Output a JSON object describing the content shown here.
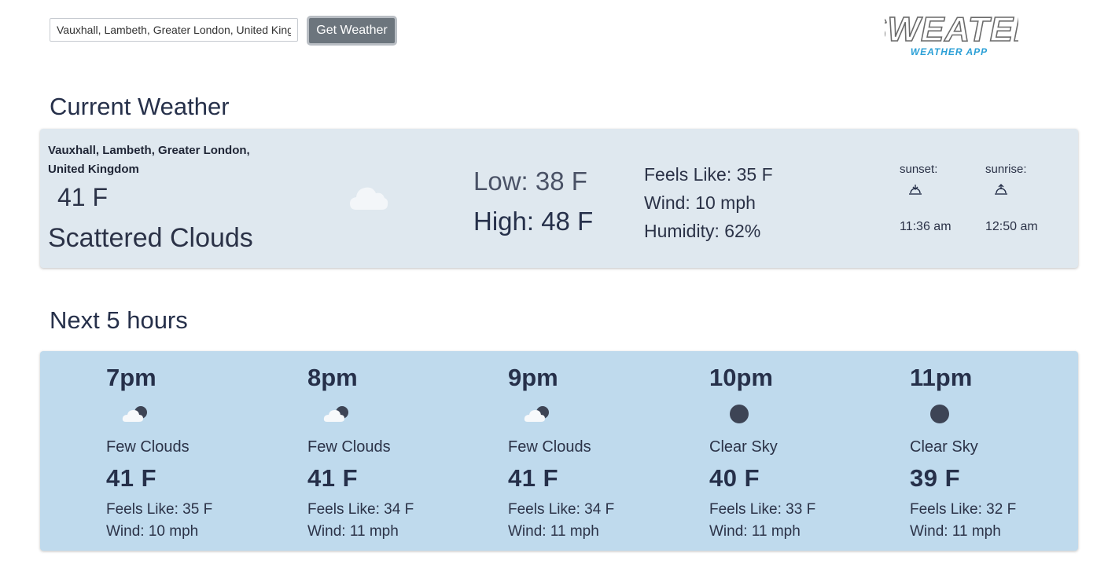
{
  "search": {
    "value": "Vauxhall, Lambeth, Greater London, United Kingdom"
  },
  "get_weather_label": "Get Weather",
  "logo": {
    "title": "SWEATER",
    "subtitle": "WEATHER APP"
  },
  "current": {
    "section_title": "Current Weather",
    "location": "Vauxhall, Lambeth, Greater London, United Kingdom",
    "temp": "41 F",
    "description": "Scattered Clouds",
    "icon": "cloud-icon",
    "low": "Low: 38 F",
    "high": "High: 48 F",
    "feels_like": "Feels Like: 35 F",
    "wind": "Wind: 10 mph",
    "humidity": "Humidity: 62%",
    "sunset_label": "sunset:",
    "sunset_time": "11:36 am",
    "sunrise_label": "sunrise:",
    "sunrise_time": "12:50 am"
  },
  "hourly": {
    "section_title": "Next 5 hours",
    "hours": [
      {
        "time": "7pm",
        "icon": "few-clouds-night-icon",
        "desc": "Few Clouds",
        "temp": "41 F",
        "feels": "Feels Like: 35 F",
        "wind": "Wind: 10 mph"
      },
      {
        "time": "8pm",
        "icon": "few-clouds-night-icon",
        "desc": "Few Clouds",
        "temp": "41 F",
        "feels": "Feels Like: 34 F",
        "wind": "Wind: 11 mph"
      },
      {
        "time": "9pm",
        "icon": "few-clouds-night-icon",
        "desc": "Few Clouds",
        "temp": "41 F",
        "feels": "Feels Like: 34 F",
        "wind": "Wind: 11 mph"
      },
      {
        "time": "10pm",
        "icon": "clear-night-icon",
        "desc": "Clear Sky",
        "temp": "40 F",
        "feels": "Feels Like: 33 F",
        "wind": "Wind: 11 mph"
      },
      {
        "time": "11pm",
        "icon": "clear-night-icon",
        "desc": "Clear Sky",
        "temp": "39 F",
        "feels": "Feels Like: 32 F",
        "wind": "Wind: 11 mph"
      }
    ]
  },
  "colors": {
    "current_card": "#dfe8ef",
    "hourly_card": "#bfdaed",
    "button": "#6c757d",
    "logo_accent": "#2a9fd6"
  }
}
